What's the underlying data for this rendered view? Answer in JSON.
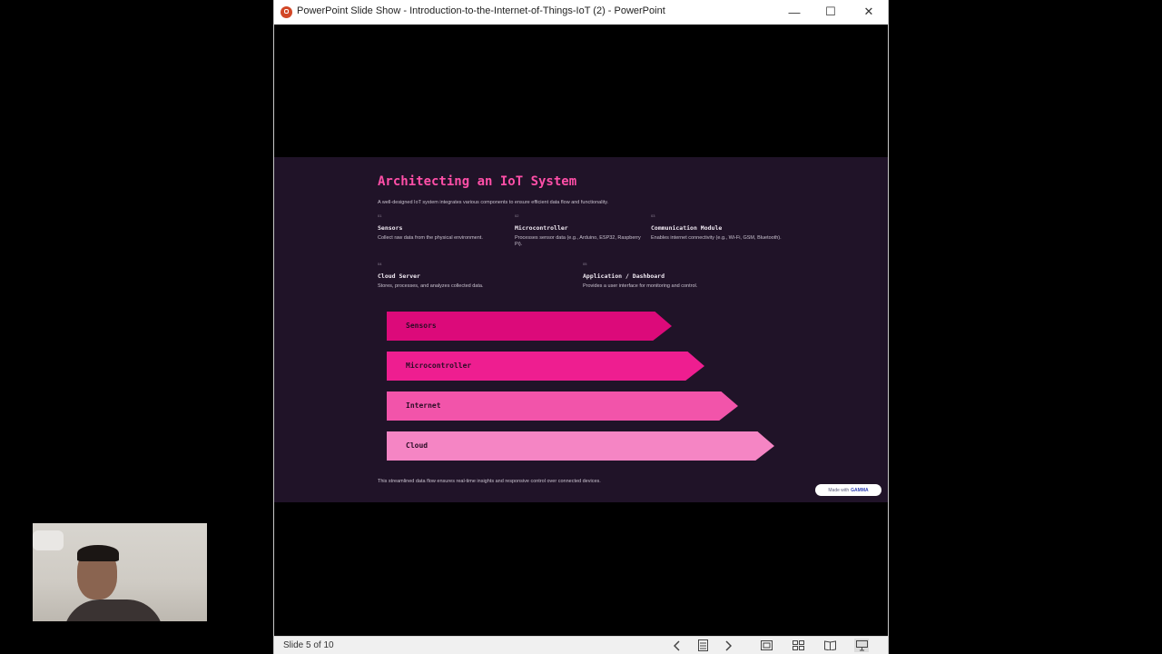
{
  "window": {
    "title": "PowerPoint Slide Show  -  Introduction-to-the-Internet-of-Things-IoT (2) - PowerPoint",
    "controls": {
      "minimize": "—",
      "maximize": "☐",
      "close": "✕"
    }
  },
  "slide": {
    "title": "Architecting an IoT System",
    "subtitle": "A well-designed IoT system integrates various components to ensure efficient data flow and functionality.",
    "components": [
      {
        "num": "01",
        "name": "Sensors",
        "desc": "Collect raw data from the physical environment."
      },
      {
        "num": "02",
        "name": "Microcontroller",
        "desc": "Processes sensor data (e.g., Arduino, ESP32, Raspberry Pi)."
      },
      {
        "num": "03",
        "name": "Communication Module",
        "desc": "Enables internet connectivity (e.g., Wi-Fi, GSM, Bluetooth)."
      },
      {
        "num": "04",
        "name": "Cloud Server",
        "desc": "Stores, processes, and analyzes collected data."
      },
      {
        "num": "05",
        "name": "Application / Dashboard",
        "desc": "Provides a user interface for monitoring and control."
      }
    ],
    "flow": [
      {
        "label": "Sensors",
        "color": "#dc0a7a"
      },
      {
        "label": "Microcontroller",
        "color": "#ee1e90"
      },
      {
        "label": "Internet",
        "color": "#f254aa"
      },
      {
        "label": "Cloud",
        "color": "#f585c4"
      }
    ],
    "footer": "This streamlined data flow ensures real-time insights and responsive control over connected devices.",
    "badge": {
      "prefix": "Made with",
      "brand": "GAMMA"
    }
  },
  "statusbar": {
    "slide_count": "Slide 5 of 10",
    "icons": [
      "previous-icon",
      "slide-navigator-icon",
      "next-icon",
      "normal-view-icon",
      "slide-sorter-icon",
      "reading-view-icon",
      "slide-show-icon"
    ]
  },
  "colors": {
    "accent": "#ff4fa8",
    "slide_bg": "#201328"
  }
}
